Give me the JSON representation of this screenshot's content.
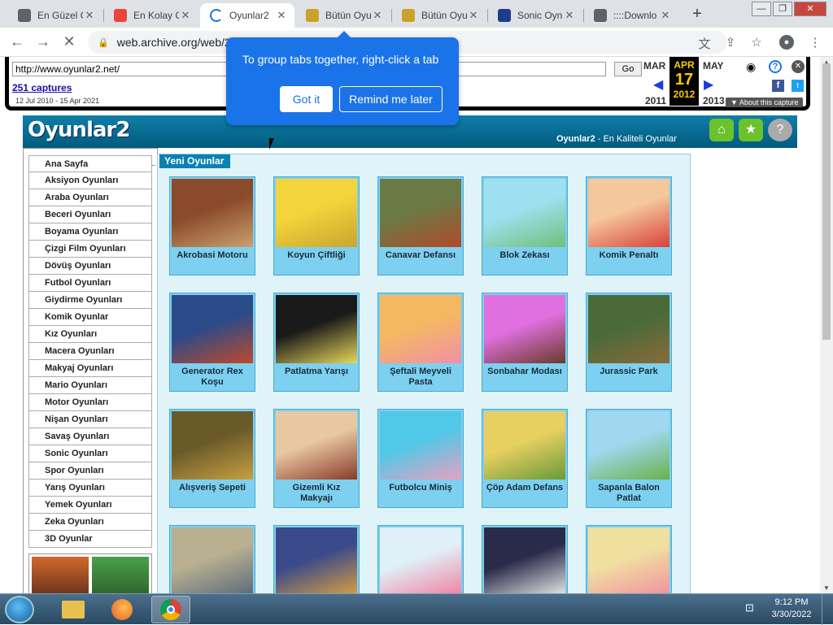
{
  "browser": {
    "tabs": [
      {
        "title": "En Güzel O",
        "favicon_color": "#5f6368",
        "icon": "globe-icon"
      },
      {
        "title": "En Kolay O",
        "favicon_color": "#e8453c",
        "icon": "shield-icon"
      },
      {
        "title": "Oyunlar2",
        "favicon_color": "#1a73e8",
        "icon": "loading-icon",
        "active": true
      },
      {
        "title": "Bütün Oyu",
        "favicon_color": "#c9a227",
        "icon": "page-icon"
      },
      {
        "title": "Bütün Oyu",
        "favicon_color": "#c9a227",
        "icon": "page-icon"
      },
      {
        "title": "Sonic Oyn",
        "favicon_color": "#1e3c8c",
        "icon": "page-icon"
      },
      {
        "title": "::::Downlo",
        "favicon_color": "#5f6368",
        "icon": "globe-icon"
      }
    ],
    "address": "web.archive.org/web/2",
    "tooltip": {
      "message": "To group tabs together, right-click a tab",
      "got_it": "Got it",
      "remind": "Remind me later"
    }
  },
  "wayback": {
    "url": "http://www.oyunlar2.net/",
    "go": "Go",
    "captures": "251 captures",
    "range": "12 Jul 2010 - 15 Apr 2021",
    "prev_month": "MAR",
    "cur_month": "APR",
    "next_month": "MAY",
    "day": "17",
    "prev_year": "2011",
    "cur_year": "2012",
    "next_year": "2013",
    "about": "▼ About this capture"
  },
  "site": {
    "logo": "Oyunlar2",
    "tagline_bold": "Oyunlar2",
    "tagline_rest": " - En Kaliteli Oyunlar",
    "section_title": "Yeni Oyunlar",
    "menu": [
      "Ana Sayfa",
      "Aksiyon Oyunları",
      "Araba Oyunları",
      "Beceri Oyunları",
      "Boyama Oyunları",
      "Çizgi Film Oyunları",
      "Dövüş Oyunları",
      "Futbol Oyunları",
      "Giydirme Oyunları",
      "Komik Oyunlar",
      "Kız Oyunları",
      "Macera Oyunları",
      "Makyaj Oyunları",
      "Mario Oyunları",
      "Motor Oyunları",
      "Nişan Oyunları",
      "Savaş Oyunları",
      "Sonic Oyunları",
      "Spor Oyunları",
      "Yarış Oyunları",
      "Yemek Oyunları",
      "Zeka Oyunları",
      "3D Oyunlar"
    ],
    "games": [
      {
        "name": "Akrobasi Motoru",
        "c1": "#8b4a2b",
        "c2": "#c9a070"
      },
      {
        "name": "Koyun Çiftliği",
        "c1": "#f3d43a",
        "c2": "#c8a530"
      },
      {
        "name": "Canavar Defansı",
        "c1": "#6b7a45",
        "c2": "#b04a2a"
      },
      {
        "name": "Blok Zekası",
        "c1": "#9fe0f0",
        "c2": "#6fc07a"
      },
      {
        "name": "Komik Penaltı",
        "c1": "#f4c89a",
        "c2": "#d8403a"
      },
      {
        "name": "Generator Rex Koşu",
        "c1": "#2a4a8a",
        "c2": "#c04a2a"
      },
      {
        "name": "Patlatma Yarışı",
        "c1": "#1a1a1a",
        "c2": "#e8d85a"
      },
      {
        "name": "Şeftali Meyveli Pasta",
        "c1": "#f4b860",
        "c2": "#f090a8"
      },
      {
        "name": "Sonbahar Modası",
        "c1": "#e070e0",
        "c2": "#6a3a2a"
      },
      {
        "name": "Jurassic Park",
        "c1": "#4a6a3a",
        "c2": "#8a6a3a"
      },
      {
        "name": "Alışveriş Sepeti",
        "c1": "#6a5a2a",
        "c2": "#c8a040"
      },
      {
        "name": "Gizemli Kız Makyajı",
        "c1": "#e8c8a0",
        "c2": "#8a3a2a"
      },
      {
        "name": "Futbolcu Miniş",
        "c1": "#50c8e8",
        "c2": "#e8a0c0"
      },
      {
        "name": "Çöp Adam Defans",
        "c1": "#e8d060",
        "c2": "#6a9a3a"
      },
      {
        "name": "Sapanla Balon Patlat",
        "c1": "#a0d8f0",
        "c2": "#6ab04a"
      },
      {
        "name": "",
        "c1": "#b8b090",
        "c2": "#5a6a7a"
      },
      {
        "name": "",
        "c1": "#3a4a8a",
        "c2": "#d8a040"
      },
      {
        "name": "",
        "c1": "#e0f0f8",
        "c2": "#f080a0"
      },
      {
        "name": "",
        "c1": "#2a2a4a",
        "c2": "#e8e8e8"
      },
      {
        "name": "",
        "c1": "#f0e0a0",
        "c2": "#f090a0"
      }
    ]
  },
  "taskbar": {
    "time": "9:12 PM",
    "date": "3/30/2022"
  }
}
